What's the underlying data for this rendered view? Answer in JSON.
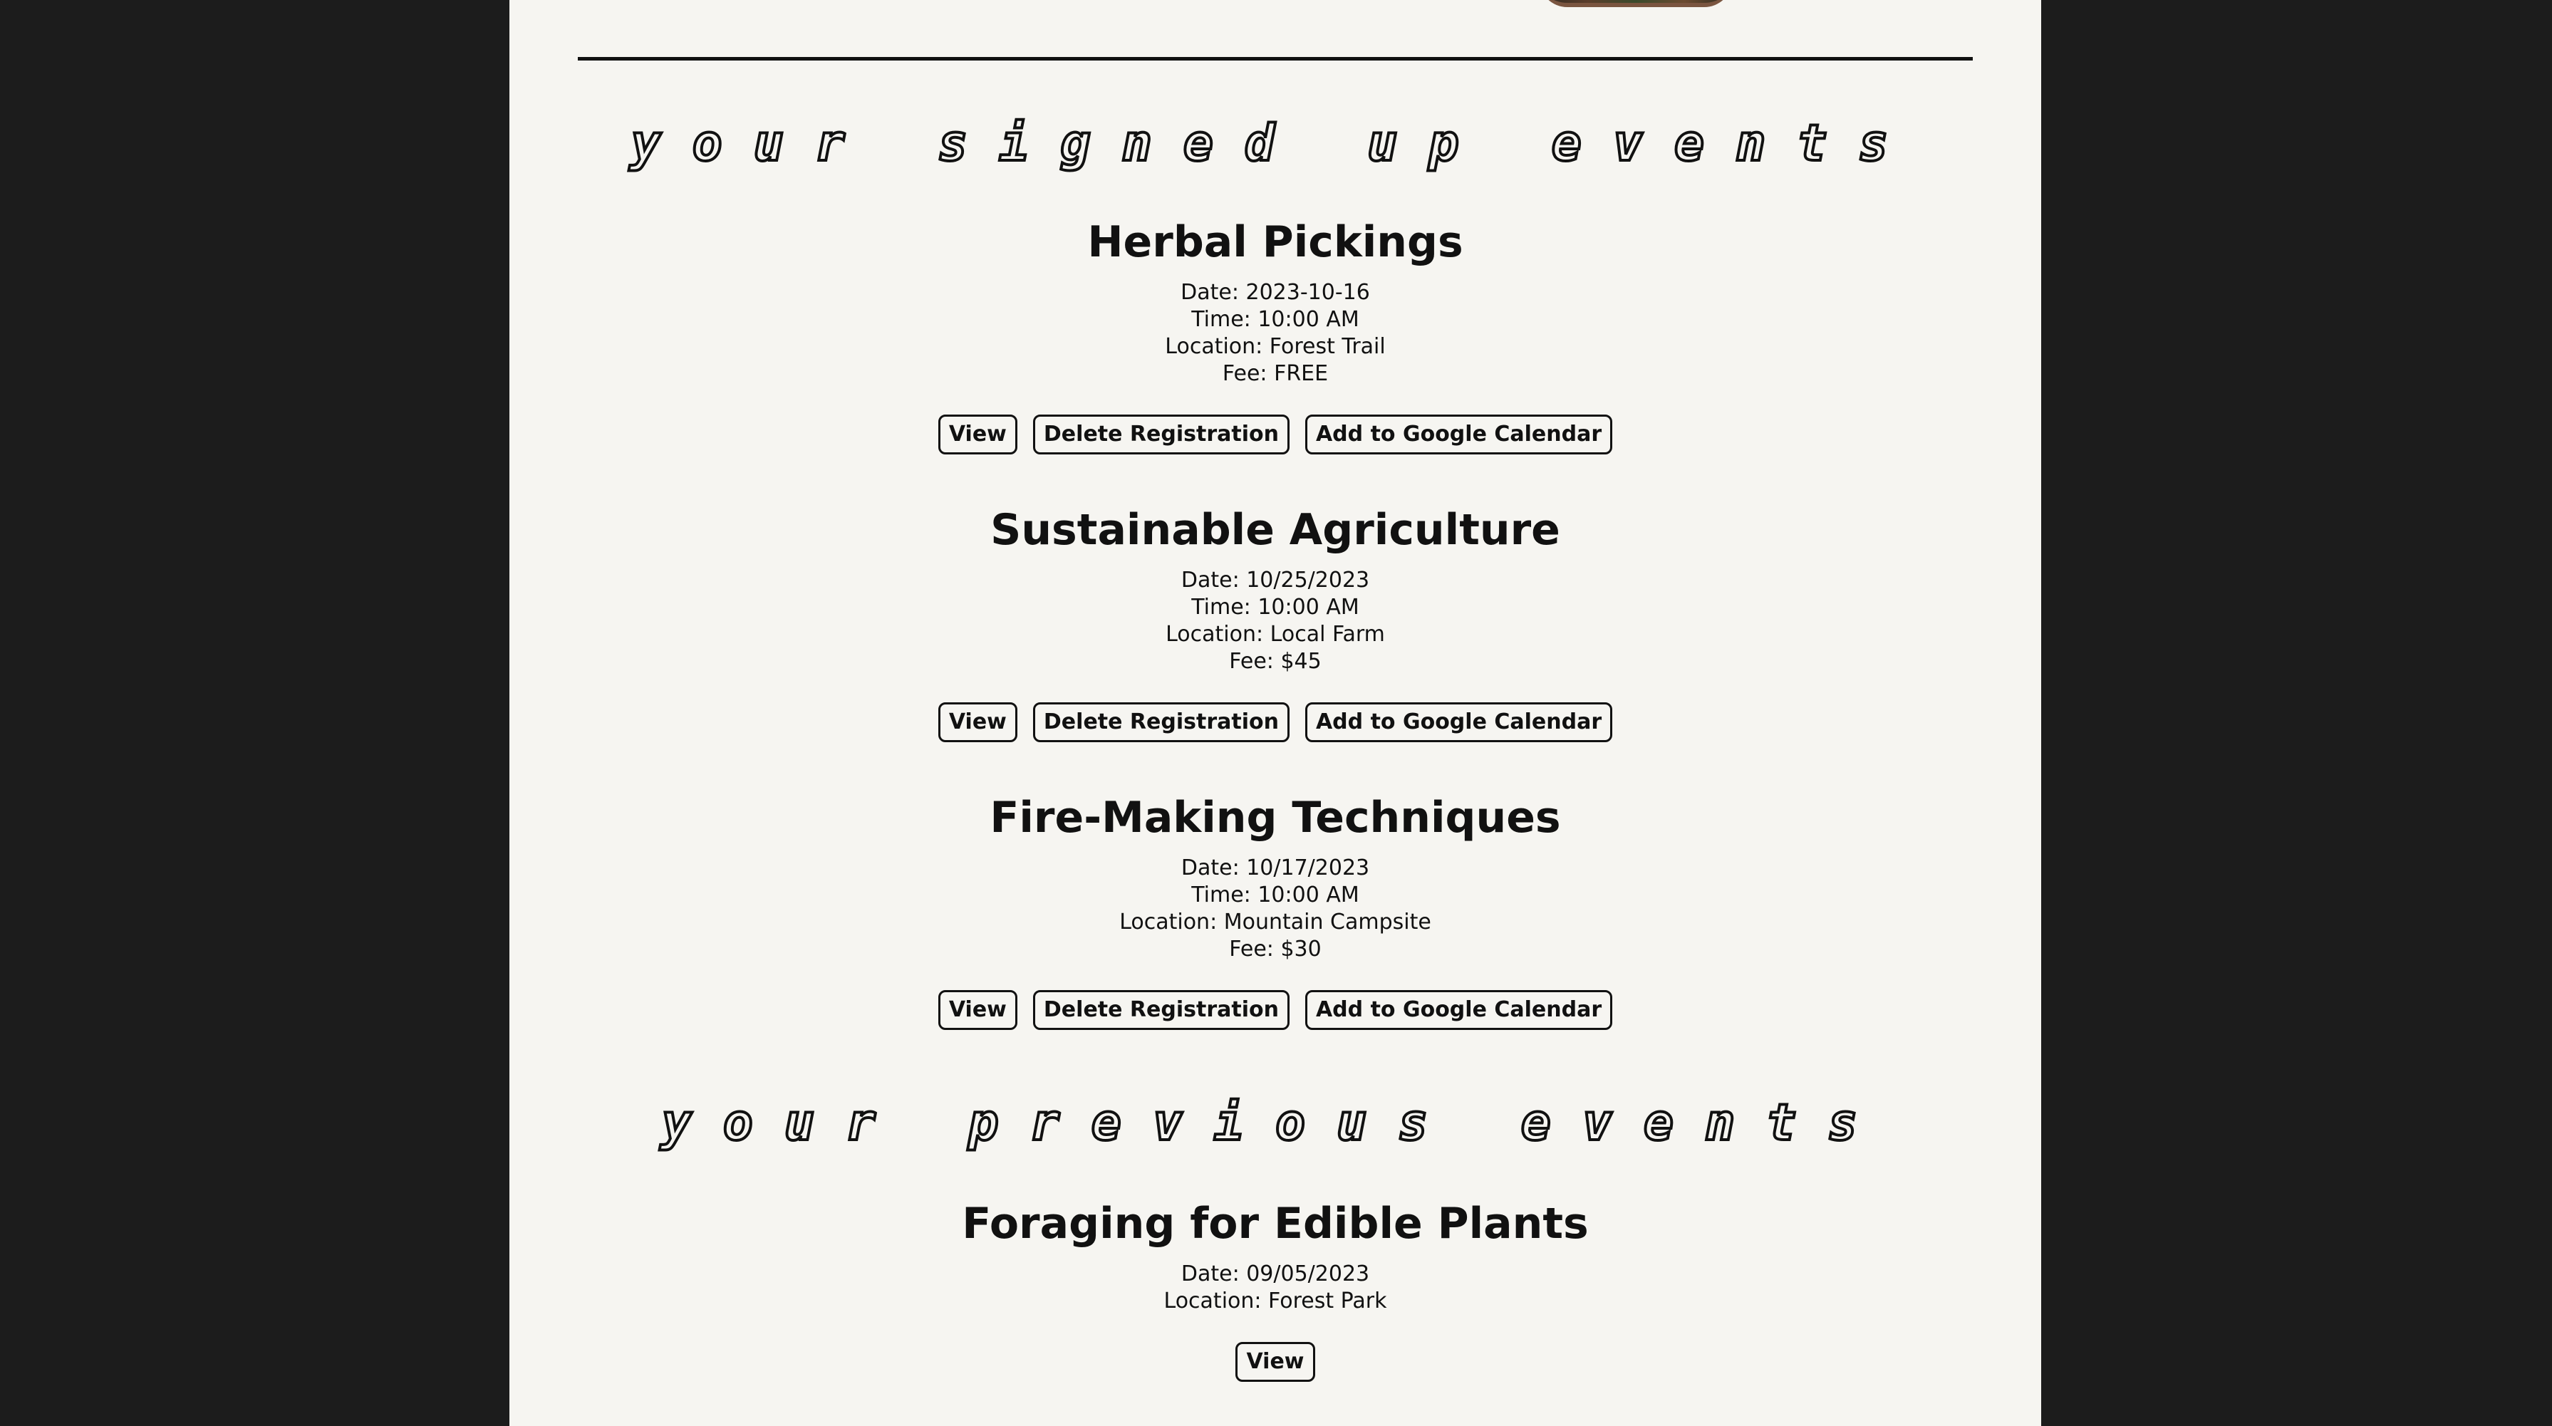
{
  "sections": {
    "signed_up_heading": "your signed up events",
    "previous_heading": "your previous events"
  },
  "buttons": {
    "view": "View",
    "delete": "Delete Registration",
    "calendar": "Add to Google Calendar"
  },
  "signed_up_events": [
    {
      "title": "Herbal Pickings",
      "date": "Date: 2023-10-16",
      "time": "Time: 10:00 AM",
      "location": "Location: Forest Trail",
      "fee": "Fee: FREE"
    },
    {
      "title": "Sustainable Agriculture",
      "date": "Date: 10/25/2023",
      "time": "Time: 10:00 AM",
      "location": "Location: Local Farm",
      "fee": "Fee: $45"
    },
    {
      "title": "Fire-Making Techniques",
      "date": "Date: 10/17/2023",
      "time": "Time: 10:00 AM",
      "location": "Location: Mountain Campsite",
      "fee": "Fee: $30"
    }
  ],
  "previous_events": [
    {
      "title": "Foraging for Edible Plants",
      "date": "Date: 09/05/2023",
      "location": "Location: Forest Park"
    }
  ]
}
